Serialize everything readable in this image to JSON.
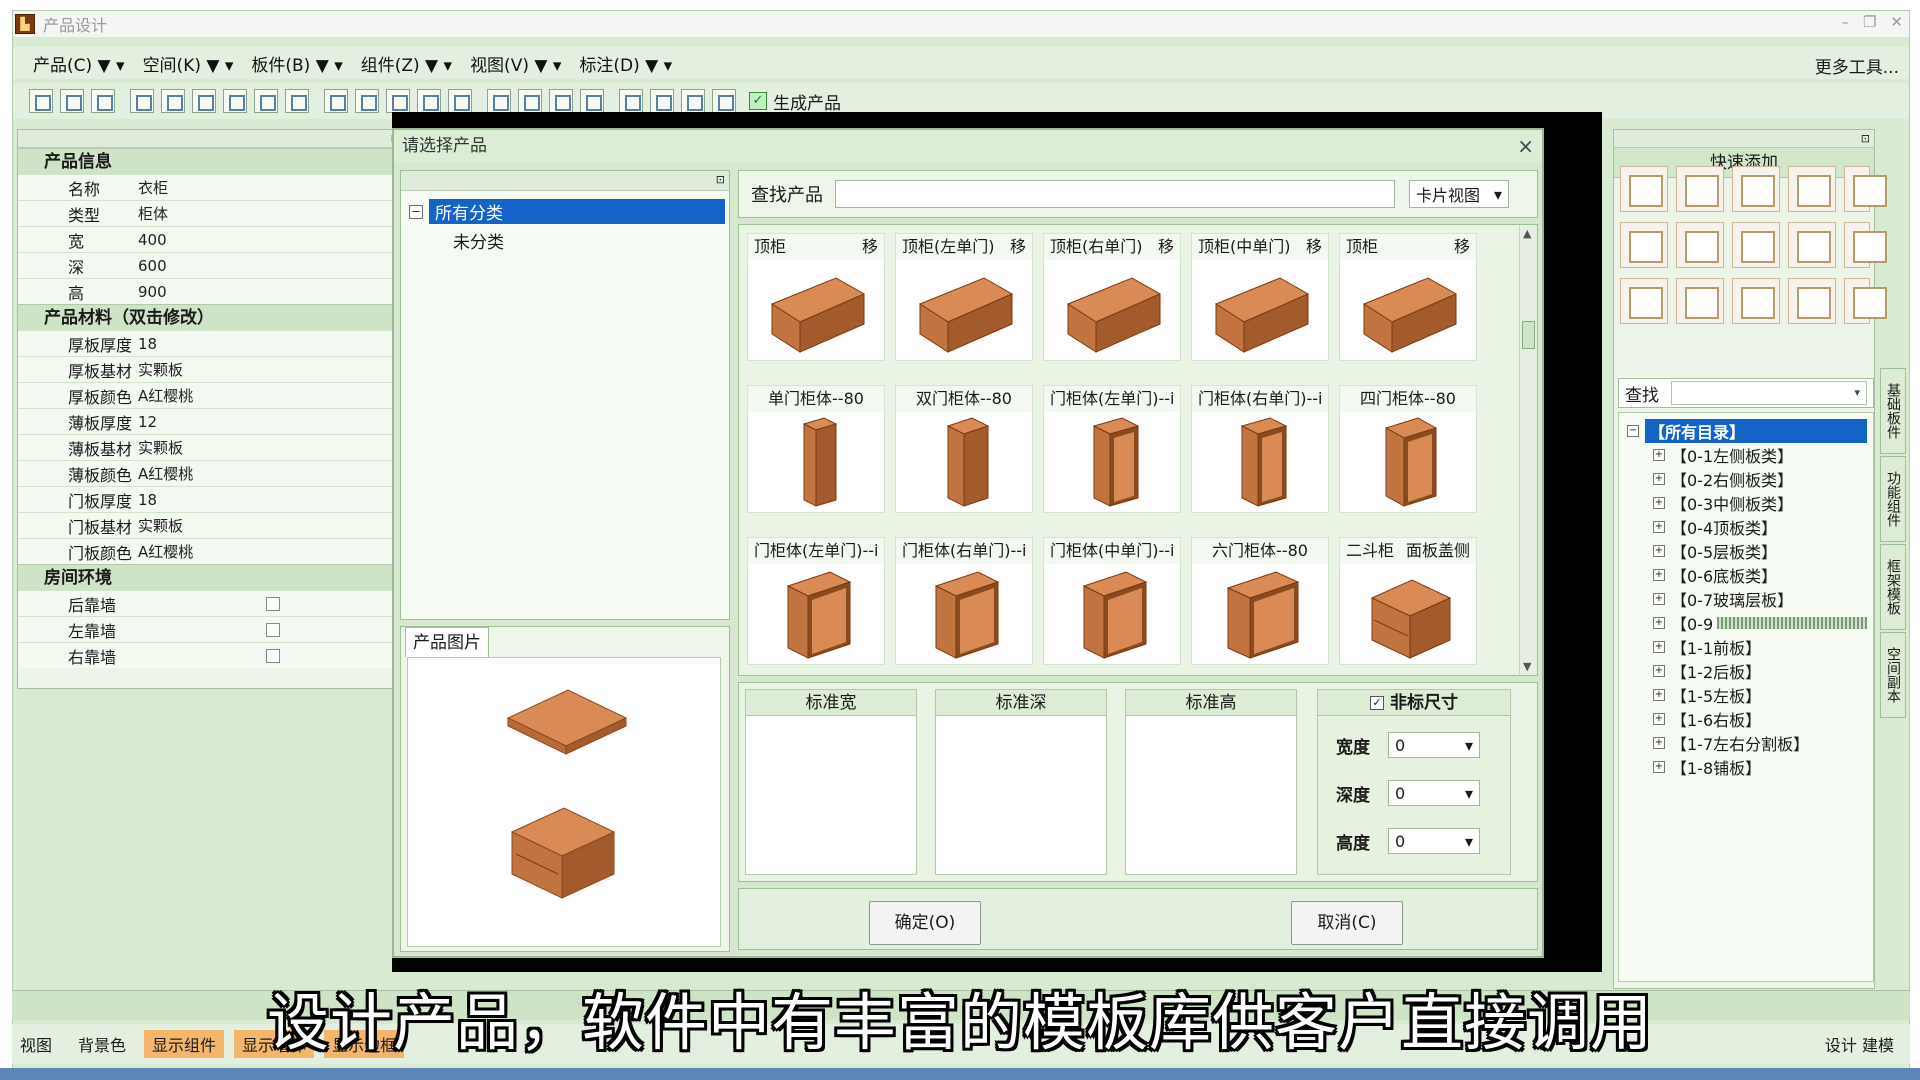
{
  "window": {
    "title": "产品设计"
  },
  "menu": {
    "items": [
      "产品(C) ▼ ▾",
      "空间(K) ▼ ▾",
      "板件(B) ▼ ▾",
      "组件(Z) ▼ ▾",
      "视图(V) ▼ ▾",
      "标注(D) ▼ ▾"
    ],
    "more": "更多工具..."
  },
  "toolbar": {
    "generate_label": "生成产品"
  },
  "left_panel": {
    "product_info_title": "产品信息",
    "product_info": [
      {
        "label": "名称",
        "value": "衣柜"
      },
      {
        "label": "类型",
        "value": "柜体"
      },
      {
        "label": "宽",
        "value": "400"
      },
      {
        "label": "深",
        "value": "600"
      },
      {
        "label": "高",
        "value": "900"
      }
    ],
    "material_title": "产品材料（双击修改）",
    "materials": [
      {
        "label": "厚板厚度",
        "value": "18"
      },
      {
        "label": "厚板基材",
        "value": "实颗板"
      },
      {
        "label": "厚板颜色",
        "value": "A红樱桃"
      },
      {
        "label": "薄板厚度",
        "value": "12"
      },
      {
        "label": "薄板基材",
        "value": "实颗板"
      },
      {
        "label": "薄板颜色",
        "value": "A红樱桃"
      },
      {
        "label": "门板厚度",
        "value": "18"
      },
      {
        "label": "门板基材",
        "value": "实颗板"
      },
      {
        "label": "门板颜色",
        "value": "A红樱桃"
      }
    ],
    "room_title": "房间环境",
    "room": [
      {
        "label": "后靠墙"
      },
      {
        "label": "左靠墙"
      },
      {
        "label": "右靠墙"
      }
    ]
  },
  "dialog": {
    "title": "请选择产品",
    "close": "×",
    "tree": {
      "root": "所有分类",
      "child": "未分类"
    },
    "image_tab": "产品图片",
    "search_label": "查找产品",
    "search_value": "",
    "view_mode": "卡片视图",
    "cards": [
      {
        "name": "顶柜",
        "tag": "移"
      },
      {
        "name": "顶柜(左单门)",
        "tag": "移"
      },
      {
        "name": "顶柜(右单门)",
        "tag": "移"
      },
      {
        "name": "顶柜(中单门)",
        "tag": "移"
      },
      {
        "name": "顶柜",
        "tag": "移"
      },
      {
        "name": "单门柜体--80",
        "tag": ""
      },
      {
        "name": "双门柜体--80",
        "tag": ""
      },
      {
        "name": "门柜体(左单门)--i",
        "tag": ""
      },
      {
        "name": "门柜体(右单门)--i",
        "tag": ""
      },
      {
        "name": "四门柜体--80",
        "tag": ""
      },
      {
        "name": "门柜体(左单门)--i",
        "tag": ""
      },
      {
        "name": "门柜体(右单门)--i",
        "tag": ""
      },
      {
        "name": "门柜体(中单门)--i",
        "tag": ""
      },
      {
        "name": "六门柜体--80",
        "tag": ""
      },
      {
        "name": "二斗柜",
        "tag": "面板盖侧"
      }
    ],
    "std_width": "标准宽",
    "std_depth": "标准深",
    "std_height": "标准高",
    "nonstandard": "非标尺寸",
    "nonstandard_checked": "✓",
    "width_label": "宽度",
    "width_value": "0",
    "depth_label": "深度",
    "depth_value": "0",
    "height_label": "高度",
    "height_value": "0",
    "ok": "确定(O)",
    "cancel": "取消(C)"
  },
  "quick_panel": {
    "title": "快速添加",
    "search_label": "查找",
    "tree": [
      "【所有目录】",
      "【0-1左侧板类】",
      "【0-2右侧板类】",
      "【0-3中侧板类】",
      "【0-4顶板类】",
      "【0-5层板类】",
      "【0-6底板类】",
      "【0-7玻璃层板】",
      "【0-9",
      "【1-1前板】",
      "【1-2后板】",
      "【1-5左板】",
      "【1-6右板】",
      "【1-7左右分割板】",
      "【1-8铺板】"
    ],
    "vtabs": [
      "基础板件",
      "功能组件",
      "框架模板",
      "空间副本"
    ]
  },
  "bottom": {
    "chips": [
      "视图",
      "背景色",
      "显示组件",
      "显示墙体",
      "显示边框"
    ],
    "right": "设计  建模"
  },
  "caption": "设计产品，软件中有丰富的模板库供客户直接调用",
  "colors": {
    "wood": "#c97a45",
    "selection": "#1464c8",
    "panel": "#d9ead3"
  }
}
